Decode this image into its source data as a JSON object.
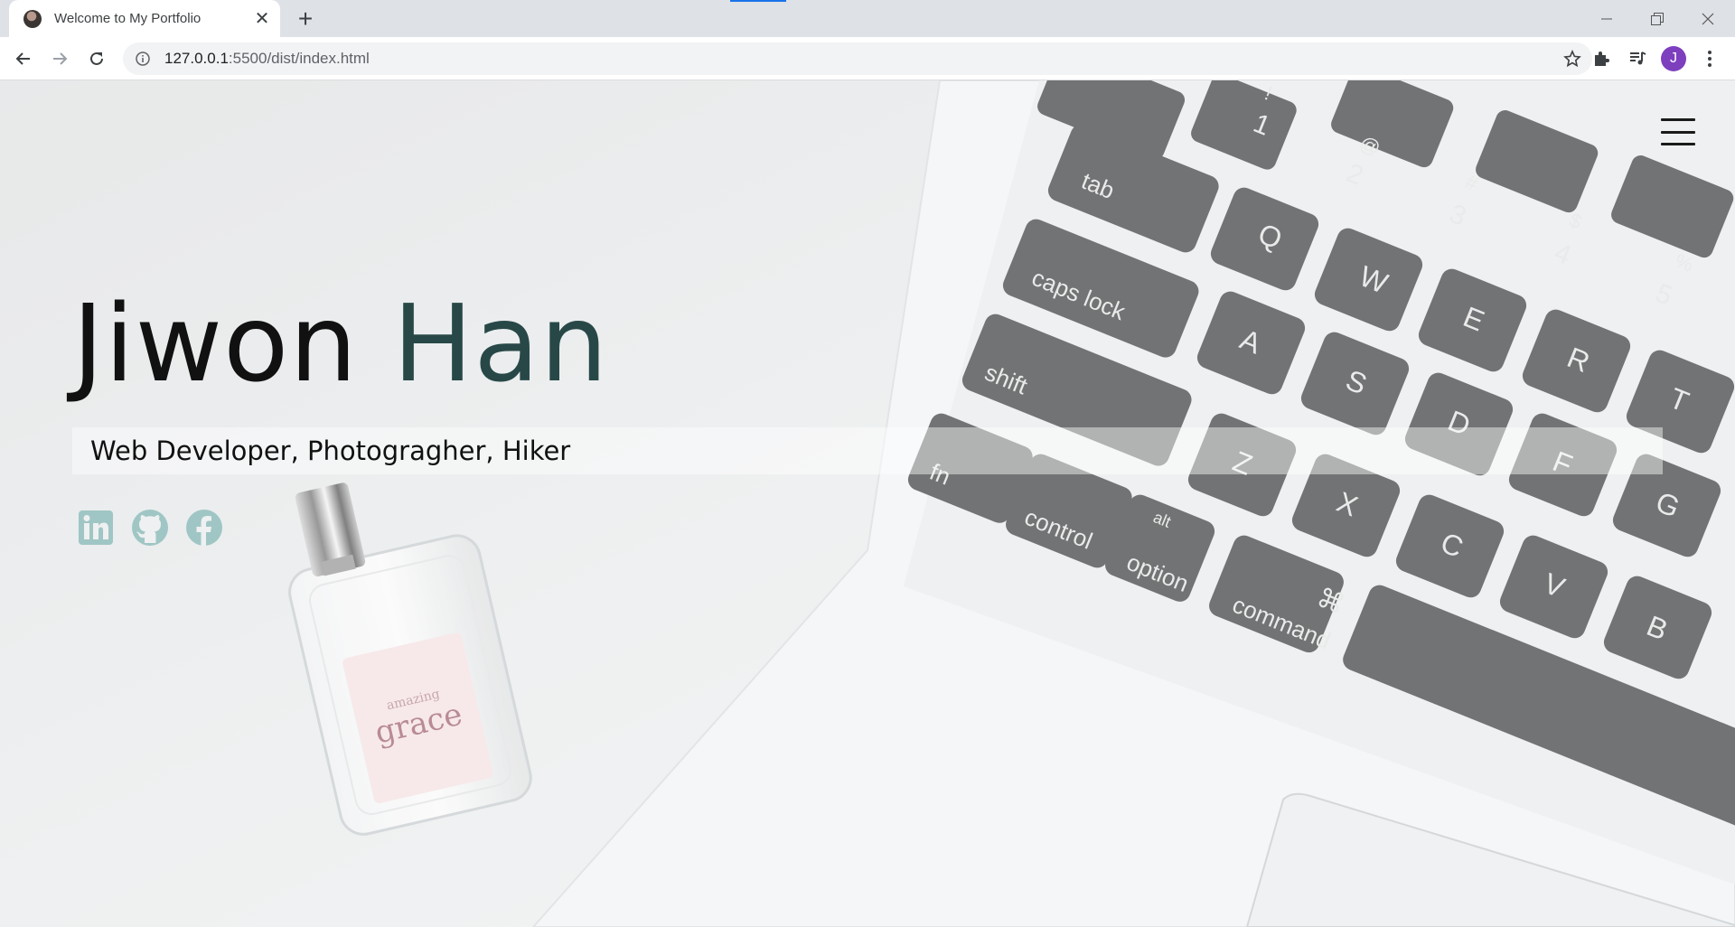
{
  "browser": {
    "tab_title": "Welcome to My Portfolio",
    "tab_close": "✕",
    "new_tab": "+",
    "url_host": "127.0.0.1",
    "url_path": ":5500/dist/index.html",
    "profile_initial": "J"
  },
  "hero": {
    "first_name": "Jiwon",
    "last_name": "Han",
    "tagline": "Web Developer, Photogragher, Hiker"
  },
  "background_photo": {
    "perfume_label_line1": "amazing",
    "perfume_label_line2": "grace",
    "keys": [
      "tab",
      "caps lock",
      "shift",
      "fn",
      "control",
      "alt",
      "option",
      "command",
      "⌘",
      "!",
      "1",
      "@",
      "2",
      "#",
      "3",
      "$",
      "4",
      "%",
      "5",
      "Q",
      "W",
      "E",
      "R",
      "T",
      "A",
      "S",
      "D",
      "F",
      "G",
      "Z",
      "X",
      "C",
      "V",
      "B"
    ]
  },
  "social": [
    {
      "name": "linkedin",
      "icon": "linkedin-icon"
    },
    {
      "name": "github",
      "icon": "github-icon"
    },
    {
      "name": "facebook",
      "icon": "facebook-icon"
    }
  ],
  "colors": {
    "accent": "#284848",
    "social_icon": "#9fc6c4",
    "key_color": "#5f6061"
  }
}
